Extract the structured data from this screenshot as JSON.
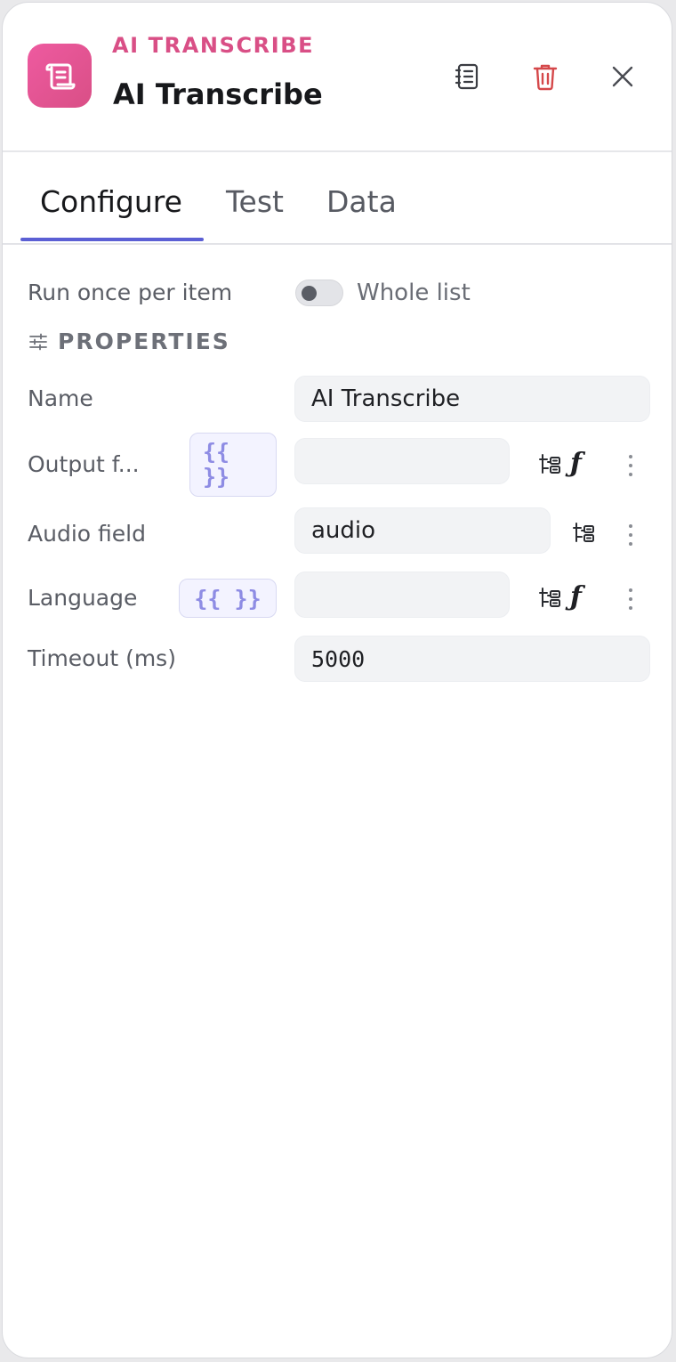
{
  "header": {
    "kicker": "AI TRANSCRIBE",
    "title": "AI Transcribe",
    "icons": {
      "app": "scroll-icon",
      "notes": "notes-icon",
      "trash": "trash-icon",
      "close": "close-icon"
    },
    "colors": {
      "accent": "#d94f86",
      "danger": "#d5484a"
    }
  },
  "tabs": [
    {
      "label": "Configure",
      "active": true
    },
    {
      "label": "Test",
      "active": false
    },
    {
      "label": "Data",
      "active": false
    }
  ],
  "mode": {
    "left_label": "Run once per item",
    "right_label": "Whole list"
  },
  "properties": {
    "title": "PROPERTIES",
    "name": {
      "label": "Name",
      "value": "AI Transcribe"
    },
    "output_field": {
      "label": "Output f...",
      "value": "",
      "tpl_open": "{{",
      "tpl_close": "}}"
    },
    "audio_field": {
      "label": "Audio field",
      "value": "audio"
    },
    "language": {
      "label": "Language",
      "value": "",
      "tpl": "{{ }}"
    },
    "timeout": {
      "label": "Timeout (ms)",
      "value": "5000"
    },
    "fx_symbol": "ƒ"
  }
}
